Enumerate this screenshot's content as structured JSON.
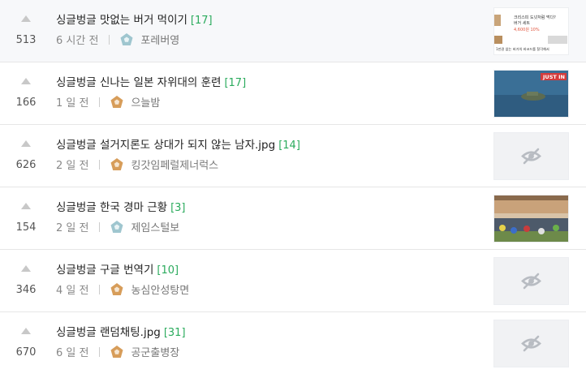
{
  "posts": [
    {
      "votes": "513",
      "title": "싱글벙글 맛없는 버거 먹이기",
      "comments": "[17]",
      "time": "6 시간 전",
      "author": "포레버영",
      "badge_color": "#9fc6cf",
      "thumb_type": "image-text",
      "thumb_text": [
        "크리스피 도넛처럼 먹다?",
        "버거 세트",
        "4,600원 10%",
        "1만권 없는 버거의 바코드를 찰각해서"
      ]
    },
    {
      "votes": "166",
      "title": "싱글벙글 신나는 일본 자위대의 훈련",
      "comments": "[17]",
      "time": "1 일 전",
      "author": "으늘밤",
      "badge_color": "#d79d5a",
      "thumb_type": "image-video",
      "thumb_text": [
        "JUST IN"
      ]
    },
    {
      "votes": "626",
      "title": "싱글벙글 설거지론도 상대가 되지 않는 남자.jpg",
      "comments": "[14]",
      "time": "2 일 전",
      "author": "킹갓임페럴제너럭스",
      "badge_color": "#d79d5a",
      "thumb_type": "hidden",
      "thumb_text": []
    },
    {
      "votes": "154",
      "title": "싱글벙글 한국 경마 근황",
      "comments": "[3]",
      "time": "2 일 전",
      "author": "제임스털보",
      "badge_color": "#9fc6cf",
      "thumb_type": "image-race",
      "thumb_text": []
    },
    {
      "votes": "346",
      "title": "싱글벙글 구글 번역기",
      "comments": "[10]",
      "time": "4 일 전",
      "author": "농심안성탕면",
      "badge_color": "#d79d5a",
      "thumb_type": "hidden",
      "thumb_text": []
    },
    {
      "votes": "670",
      "title": "싱글벙글 랜덤채팅.jpg",
      "comments": "[31]",
      "time": "6 일 전",
      "author": "공군출병장",
      "badge_color": "#d79d5a",
      "thumb_type": "hidden",
      "thumb_text": []
    }
  ]
}
